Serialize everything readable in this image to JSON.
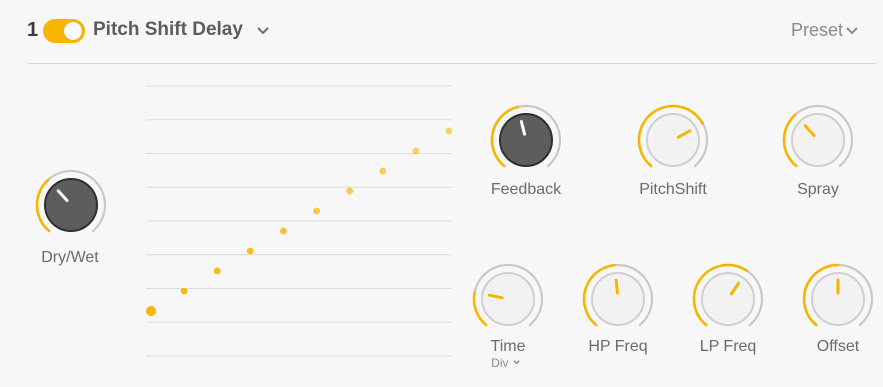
{
  "header": {
    "slot_number": "1",
    "effect_name": "Pitch Shift Delay",
    "preset_label": "Preset",
    "enabled": true
  },
  "colors": {
    "accent": "#f7b500",
    "track": "#c8c8c8",
    "knob_dark": "#5d5d5d",
    "knob_light": "#f2f2f2",
    "grid_line": "#dcdcdc"
  },
  "knobs": {
    "dry_wet": {
      "label": "Dry/Wet",
      "value": 0.35
    },
    "feedback": {
      "label": "Feedback",
      "value": 0.45
    },
    "pitch_shift": {
      "label": "PitchShift",
      "value": 0.72
    },
    "spray": {
      "label": "Spray",
      "value": 0.35
    },
    "time": {
      "label": "Time",
      "sublabel": "Div",
      "value": 0.22
    },
    "hp_freq": {
      "label": "HP Freq",
      "value": 0.48
    },
    "lp_freq": {
      "label": "LP Freq",
      "value": 0.62
    },
    "offset": {
      "label": "Offset",
      "value": 0.5
    }
  },
  "visualization": {
    "type": "scatter",
    "x": [
      0,
      1,
      2,
      3,
      4,
      5,
      6,
      7,
      8,
      9
    ],
    "y": [
      0,
      1,
      2,
      3,
      4,
      5,
      6,
      7,
      8,
      9
    ],
    "gridlines": 9
  },
  "icons": {
    "effect_menu": "chevron-down-icon",
    "preset_menu": "chevron-down-icon",
    "time_div_menu": "chevron-down-icon"
  }
}
